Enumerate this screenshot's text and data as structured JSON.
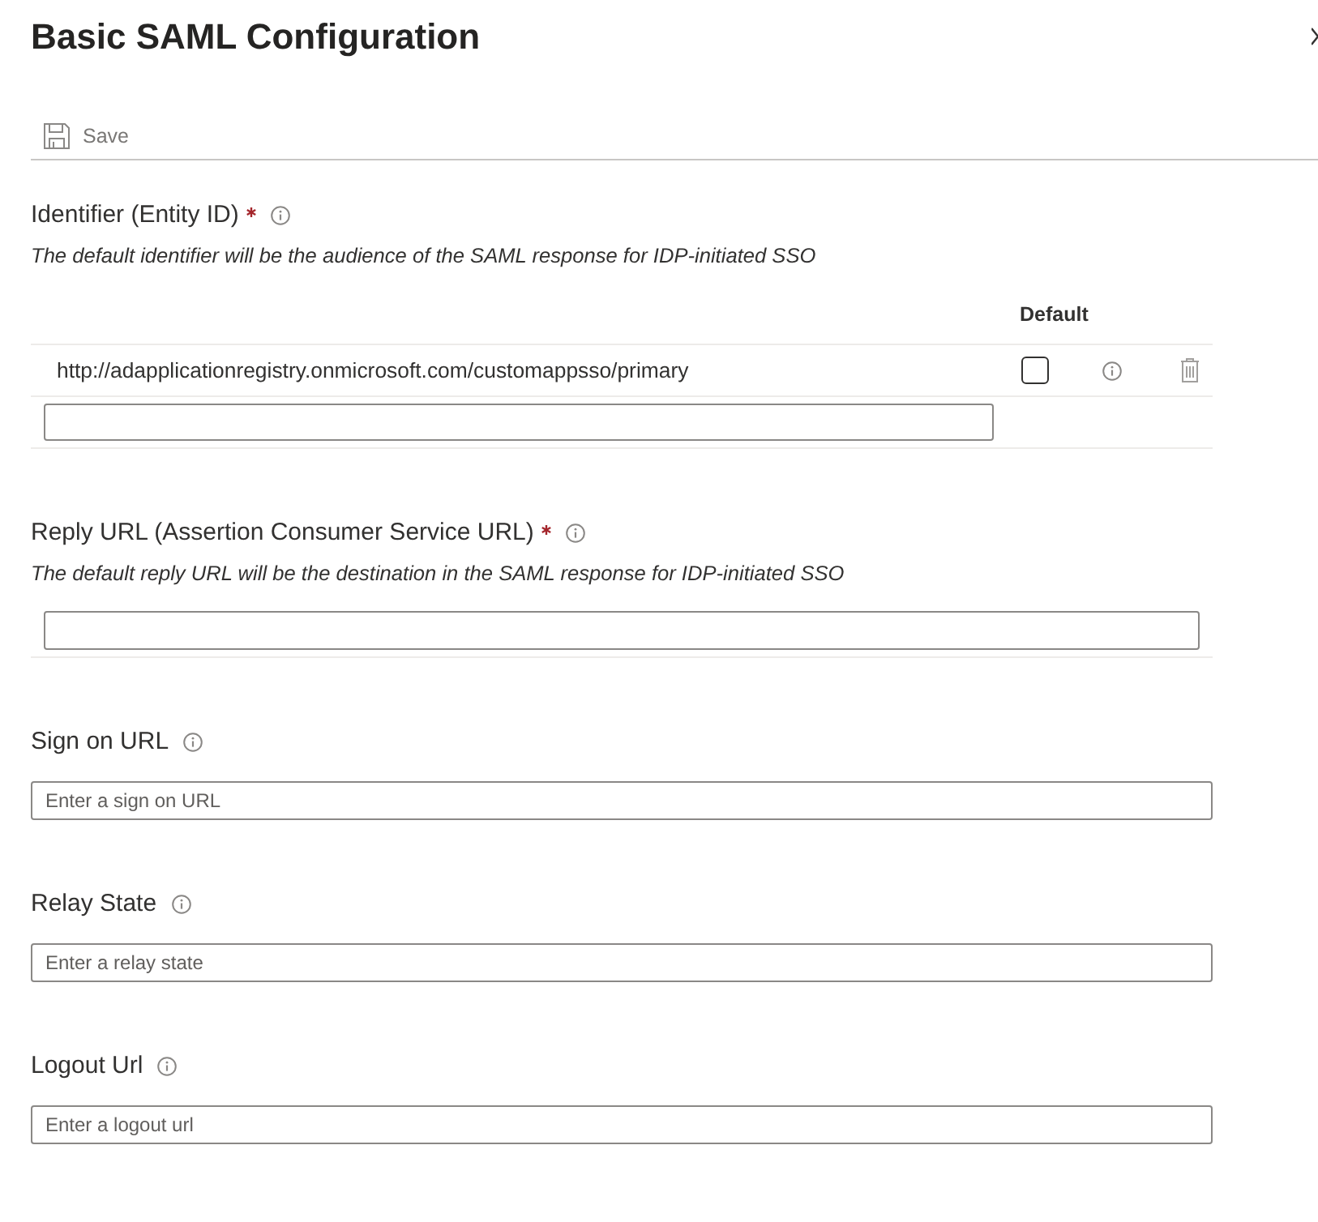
{
  "title": "Basic SAML Configuration",
  "toolbar": [
    {
      "kind": "save",
      "label": "Save",
      "disabled": true
    }
  ],
  "sections": [
    {
      "kind": "list",
      "label": "Identifier (Entity ID)",
      "required": true,
      "description": "The default identifier will be the audience of the SAML response for IDP-initiated SSO",
      "columns": [
        "Default"
      ],
      "rows": [
        {
          "value": "http://adapplicationregistry.onmicrosoft.com/customappsso/primary",
          "default": false
        }
      ]
    },
    {
      "kind": "list",
      "label": "Reply URL (Assertion Consumer Service URL)",
      "required": true,
      "description": "The default reply URL will be the destination in the SAML response for IDP-initiated SSO"
    },
    {
      "kind": "field",
      "label": "Sign on URL",
      "placeholder": "Enter a sign on URL"
    },
    {
      "kind": "field",
      "label": "Relay State",
      "placeholder": "Enter a relay state"
    },
    {
      "kind": "field",
      "label": "Logout Url",
      "placeholder": "Enter a logout url"
    }
  ]
}
